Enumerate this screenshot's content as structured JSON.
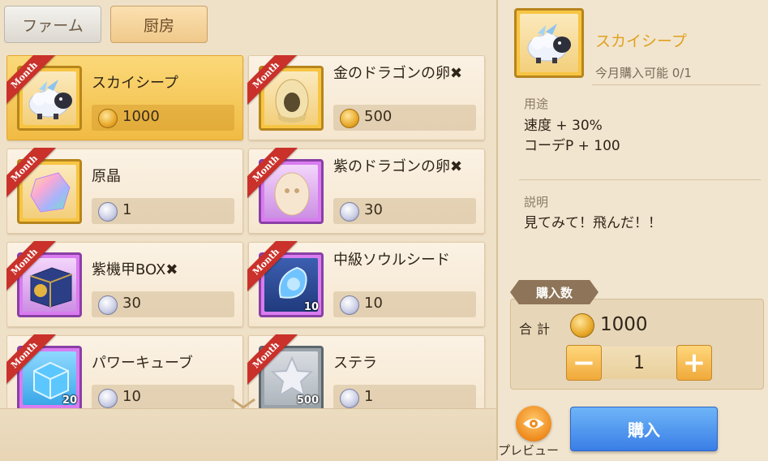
{
  "tabs": [
    {
      "label": "ファーム"
    },
    {
      "label": "厨房"
    }
  ],
  "items": [
    {
      "name": "スカイシープ",
      "price": "1000",
      "badge": "Month",
      "currency": "gold-coin",
      "icon": "sky-sheep-icon"
    },
    {
      "name": "金のドラゴンの卵✖",
      "price": "500",
      "badge": "Month",
      "currency": "gold-coin",
      "icon": "gold-dragon-egg-icon"
    },
    {
      "name": "原晶",
      "price": "1",
      "badge": "Month",
      "currency": "silver-coin",
      "icon": "crystal-icon"
    },
    {
      "name": "紫のドラゴンの卵✖",
      "price": "30",
      "badge": "Month",
      "currency": "silver-coin",
      "icon": "purple-dragon-egg-icon"
    },
    {
      "name": "紫機甲BOX✖",
      "price": "30",
      "badge": "Month",
      "currency": "silver-coin",
      "icon": "mecha-box-icon"
    },
    {
      "name": "中級ソウルシード",
      "price": "10",
      "badge": "Month",
      "currency": "silver-coin",
      "icon": "soul-seed-icon",
      "qty": "10"
    },
    {
      "name": "パワーキューブ",
      "price": "10",
      "badge": "Month",
      "currency": "silver-coin",
      "icon": "power-cube-icon",
      "qty": "20"
    },
    {
      "name": "ステラ",
      "price": "1",
      "badge": "Month",
      "currency": "silver-coin",
      "icon": "star-icon",
      "qty": "500"
    }
  ],
  "detail": {
    "name": "スカイシープ",
    "limit": "今月購入可能 0/1",
    "usage_label": "用途",
    "usage_lines": [
      "速度 + 30%",
      "コーデP + 100"
    ],
    "desc_label": "説明",
    "desc_text": "見てみて！飛んだ！！"
  },
  "purchase": {
    "qty_tag": "購入数",
    "total_label": "合計",
    "total_value": "1000",
    "minus": "−",
    "plus": "+",
    "quantity": "1",
    "preview_label": "プレビュー",
    "buy_label": "購入"
  },
  "colors": {
    "accent_gold": "#e0a11f",
    "buy_button": "#3a7ee6",
    "ribbon": "#c9312a"
  }
}
